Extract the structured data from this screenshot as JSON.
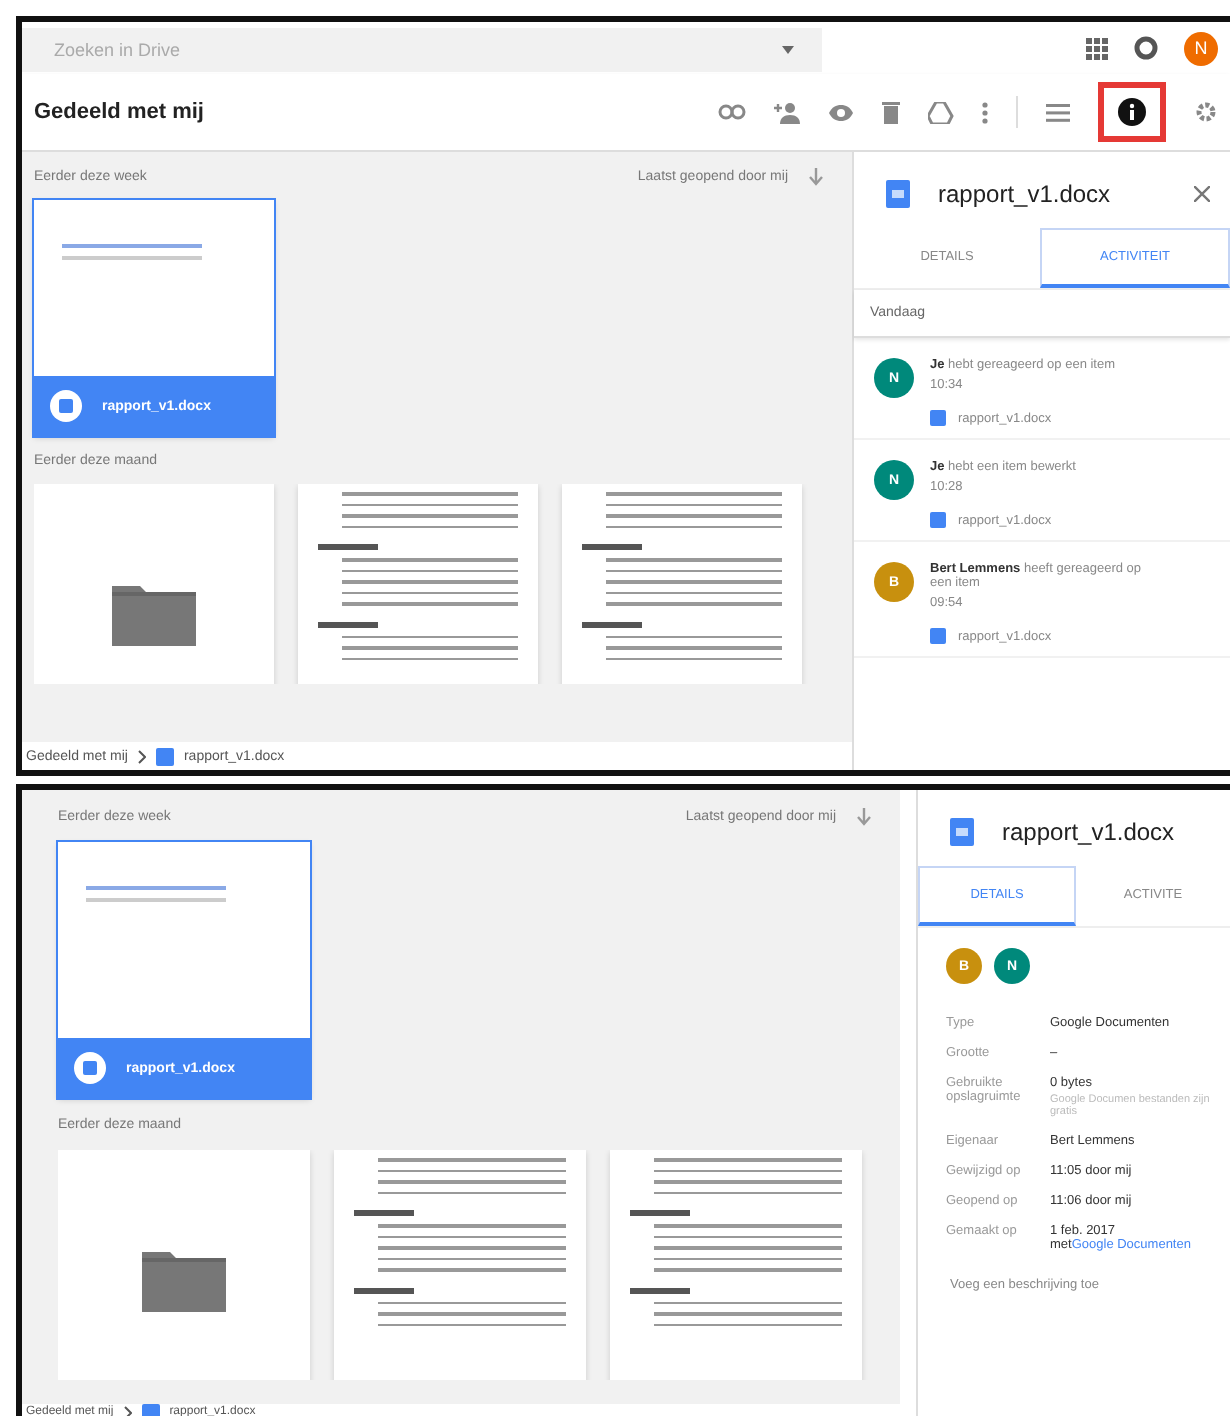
{
  "frames": [
    {
      "header": {
        "search": {
          "placeholder": "Zoeken in Drive"
        },
        "account_initial": "N",
        "title": "Gedeeld met mij",
        "info_highlighted": true
      },
      "files": {
        "sort": "Laatst geopend door mij",
        "sections": [
          {
            "heading": "Eerder deze week",
            "items": [
              {
                "kind": "doc",
                "name": "rapport_v1.docx",
                "selected": true
              }
            ]
          },
          {
            "heading": "Eerder deze maand",
            "items": [
              {
                "kind": "folder",
                "selected": false
              },
              {
                "kind": "page",
                "selected": false
              },
              {
                "kind": "page",
                "selected": false
              }
            ]
          }
        ],
        "breadcrumb": [
          "Gedeeld met mij",
          "rapport_v1.docx"
        ]
      },
      "panel": {
        "kind": "activity",
        "file_name": "rapport_v1.docx",
        "closable": true,
        "tabs": [
          {
            "label": "DETAILS",
            "selected": false
          },
          {
            "label": "ACTIVITEIT",
            "selected": true
          }
        ],
        "day": "Vandaag",
        "activities": [
          {
            "initial": "N",
            "color": "#00897b",
            "text": "**Je** hebt gereageerd op een item",
            "time": "10:34",
            "file": "rapport_v1.docx"
          },
          {
            "initial": "N",
            "color": "#00897b",
            "text": "**Je** hebt een item bewerkt",
            "time": "10:28",
            "file": "rapport_v1.docx"
          },
          {
            "initial": "B",
            "color": "#c8900e",
            "text": "**Bert Lemmens** heeft gereageerd op een item",
            "time": "09:54",
            "file": "rapport_v1.docx"
          }
        ]
      }
    },
    {
      "files": {
        "sort": "Laatst geopend door mij",
        "sections": [
          {
            "heading": "Eerder deze week",
            "items": [
              {
                "kind": "doc",
                "name": "rapport_v1.docx",
                "selected": true
              }
            ]
          },
          {
            "heading": "Eerder deze maand",
            "items": [
              {
                "kind": "folder",
                "selected": false
              },
              {
                "kind": "page",
                "selected": false
              },
              {
                "kind": "page",
                "selected": false
              }
            ]
          }
        ],
        "breadcrumb": [
          "Gedeeld met mij",
          "rapport_v1.docx"
        ]
      },
      "panel": {
        "kind": "details",
        "file_name": "rapport_v1.docx",
        "closable": false,
        "tabs": [
          {
            "label": "DETAILS",
            "selected": true
          },
          {
            "label": "ACTIVITE",
            "selected": false
          }
        ],
        "people": [
          {
            "initial": "B",
            "color": "#c8900e"
          },
          {
            "initial": "N",
            "color": "#00897b"
          }
        ],
        "properties": [
          {
            "label": "Type",
            "value": "Google Documenten"
          },
          {
            "label": "Grootte",
            "value": "–"
          },
          {
            "label": "Gebruikte opslagruimte",
            "value": "0 bytes",
            "note": "Google Documen bestanden zijn gratis"
          },
          {
            "label": "Eigenaar",
            "value": "Bert Lemmens"
          },
          {
            "label": "Gewijzigd op",
            "value": "11:05 door mij"
          },
          {
            "label": "Geopend op",
            "value": "11:06 door mij"
          },
          {
            "label": "Gemaakt op",
            "value": "1 feb. 2017 met",
            "link": "Google Documenten"
          }
        ],
        "description": {
          "placeholder": "Voeg een beschrijving toe"
        }
      }
    }
  ]
}
